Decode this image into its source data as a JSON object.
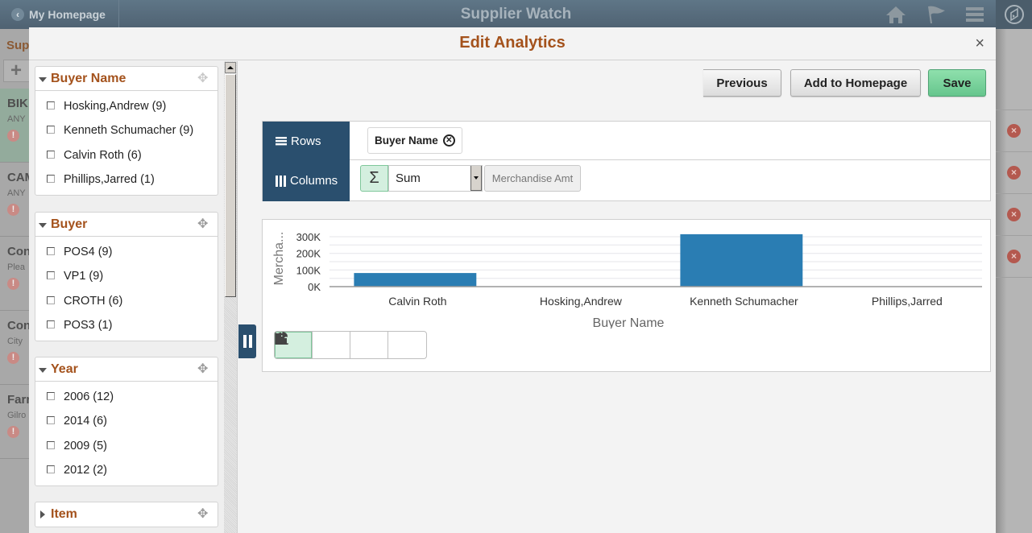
{
  "app_header": {
    "back_label": "My Homepage",
    "title": "Supplier Watch",
    "icons": [
      "home-icon",
      "flag-icon",
      "menu-icon",
      "navbar-compass-icon"
    ]
  },
  "background_page": {
    "section_title": "Sup",
    "add_label": "+",
    "cards": [
      {
        "title": "BIK",
        "subtitle": "ANY",
        "warn": "V"
      },
      {
        "title": "CAM",
        "subtitle": "ANY",
        "warn": "V"
      },
      {
        "title": "Con",
        "subtitle": "Plea",
        "warn": "V"
      },
      {
        "title": "Con",
        "subtitle": "City",
        "warn": "V"
      },
      {
        "title": "Farr",
        "subtitle": "Gilro",
        "warn": "V"
      }
    ]
  },
  "modal": {
    "title": "Edit Analytics",
    "close_label": "×"
  },
  "facets": [
    {
      "title": "Buyer Name",
      "expanded": true,
      "items": [
        "Hosking,Andrew (9)",
        "Kenneth Schumacher (9)",
        "Calvin Roth (6)",
        "Phillips,Jarred (1)"
      ]
    },
    {
      "title": "Buyer",
      "expanded": true,
      "items": [
        "POS4 (9)",
        "VP1 (9)",
        "CROTH (6)",
        "POS3 (1)"
      ]
    },
    {
      "title": "Year",
      "expanded": true,
      "items": [
        "2006 (12)",
        "2014 (6)",
        "2009 (5)",
        "2012 (2)"
      ]
    },
    {
      "title": "Item",
      "expanded": false,
      "items": []
    }
  ],
  "actions": {
    "previous": "Previous",
    "add_to_homepage": "Add to Homepage",
    "save": "Save"
  },
  "pivot": {
    "rows_label": "Rows",
    "columns_label": "Columns",
    "row_field": "Buyer Name",
    "aggregate_symbol": "Σ",
    "aggregate": "Sum",
    "measure": "Merchandise Amt"
  },
  "chart_types": [
    {
      "name": "bar-chart",
      "active": true
    },
    {
      "name": "line-chart",
      "active": false
    },
    {
      "name": "pie-chart",
      "active": false
    },
    {
      "name": "horizontal-bar-chart",
      "active": false
    }
  ],
  "colors": {
    "accent": "#a4521c",
    "bar": "#2a7db3",
    "pivot_label_bg": "#2a4f6e",
    "save_green": "#66c58d"
  },
  "chart_data": {
    "type": "bar",
    "title": "",
    "xlabel": "Buyer Name",
    "ylabel": "Mercha...",
    "categories": [
      "Calvin Roth",
      "Hosking,Andrew",
      "Kenneth Schumacher",
      "Phillips,Jarred"
    ],
    "values": [
      82000,
      0,
      315000,
      0
    ],
    "ylim": [
      0,
      300000
    ],
    "yticks": [
      0,
      100000,
      200000,
      300000
    ],
    "ytick_labels": [
      "0K",
      "100K",
      "200K",
      "300K"
    ],
    "minor_gridlines_per_major": 2,
    "grid": true,
    "legend": "none"
  }
}
